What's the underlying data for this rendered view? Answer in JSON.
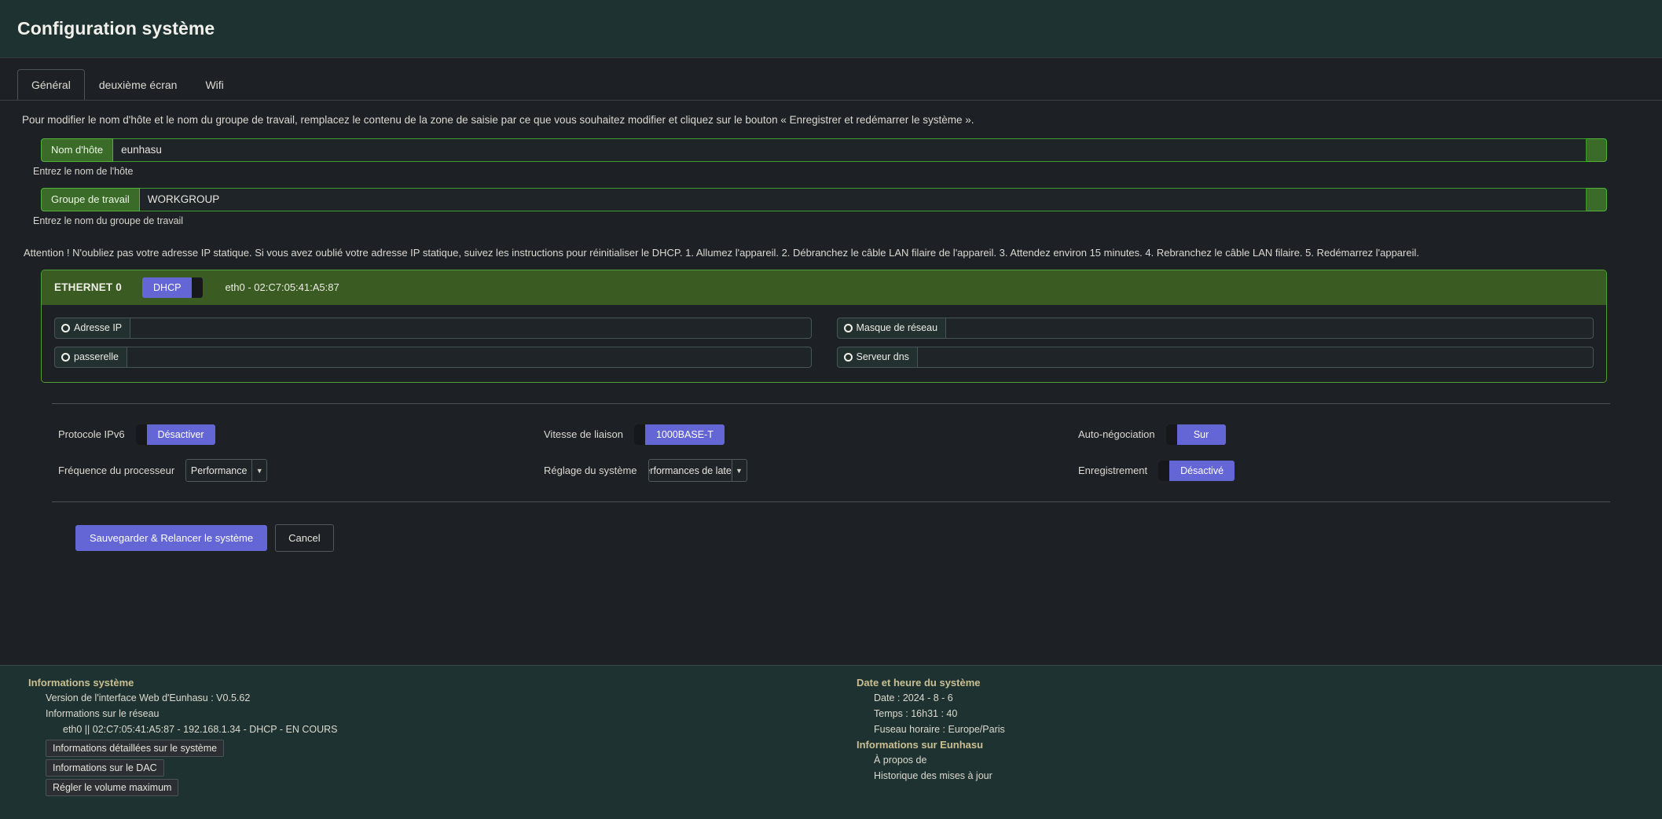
{
  "header": {
    "title": "Configuration système"
  },
  "tabs": [
    {
      "label": "Général",
      "active": true
    },
    {
      "label": "deuxième écran",
      "active": false
    },
    {
      "label": "Wifi",
      "active": false
    }
  ],
  "intro": "Pour modifier le nom d'hôte et le nom du groupe de travail, remplacez le contenu de la zone de saisie par ce que vous souhaitez modifier et cliquez sur le bouton « Enregistrer et redémarrer le système ».",
  "hostname": {
    "label": "Nom d'hôte",
    "value": "eunhasu",
    "placeholder": "",
    "help": "Entrez le nom de l'hôte"
  },
  "workgroup": {
    "label": "Groupe de travail",
    "value": "WORKGROUP",
    "placeholder": "",
    "help": "Entrez le nom du groupe de travail"
  },
  "warning": "Attention ! N'oubliez pas votre adresse IP statique. Si vous avez oublié votre adresse IP statique, suivez les instructions pour réinitialiser le DHCP. 1. Allumez l'appareil. 2. Débranchez le câble LAN filaire de l'appareil. 3. Attendez environ 15 minutes. 4. Rebranchez le câble LAN filaire. 5. Redémarrez l'appareil.",
  "ethernet": {
    "name": "ETHERNET 0",
    "dhcp_label": "DHCP",
    "interface": "eth0  -  02:C7:05:41:A5:87",
    "fields": {
      "ip": {
        "label": "Adresse IP",
        "value": ""
      },
      "netmask": {
        "label": "Masque de réseau",
        "value": ""
      },
      "gateway": {
        "label": "passerelle",
        "value": ""
      },
      "dns": {
        "label": "Serveur dns",
        "value": ""
      }
    }
  },
  "settings": {
    "ipv6": {
      "label": "Protocole IPv6",
      "value": "Désactiver"
    },
    "cpu_freq": {
      "label": "Fréquence du processeur",
      "value": "Performance"
    },
    "link_speed": {
      "label": "Vitesse de liaison",
      "value": "1000BASE-T"
    },
    "system_tuning": {
      "label": "Réglage du système",
      "value": "Performances de latenc"
    },
    "auto_negotiation": {
      "label": "Auto-négociation",
      "value": "Sur"
    },
    "logging": {
      "label": "Enregistrement",
      "value": "Désactivé"
    }
  },
  "actions": {
    "save": "Sauvegarder & Relancer le système",
    "cancel": "Cancel"
  },
  "footer": {
    "system_info": {
      "heading": "Informations système",
      "version": "Version de l'interface Web d'Eunhasu : V0.5.62",
      "network_heading": "Informations sur le réseau",
      "network_detail": "eth0 || 02:C7:05:41:A5:87 - 192.168.1.34 - DHCP - EN COURS",
      "links": [
        "Informations détaillées sur le système",
        "Informations sur le DAC",
        "Régler le volume maximum"
      ]
    },
    "datetime": {
      "heading": "Date et heure du système",
      "date": "Date : 2024 - 8 - 6",
      "time": "Temps :  16h31 : 40",
      "timezone": "Fuseau horaire : Europe/Paris"
    },
    "about": {
      "heading": "Informations sur Eunhasu",
      "links": [
        "À propos de",
        "Historique des mises à jour"
      ]
    }
  },
  "colors": {
    "header_bg": "#1e3331",
    "page_bg": "#1d2125",
    "accent_green": "#3a6b28",
    "accent_purple": "#6366d4",
    "eth_header_bg": "#3a5c22",
    "footer_heading": "#cbbf92"
  }
}
